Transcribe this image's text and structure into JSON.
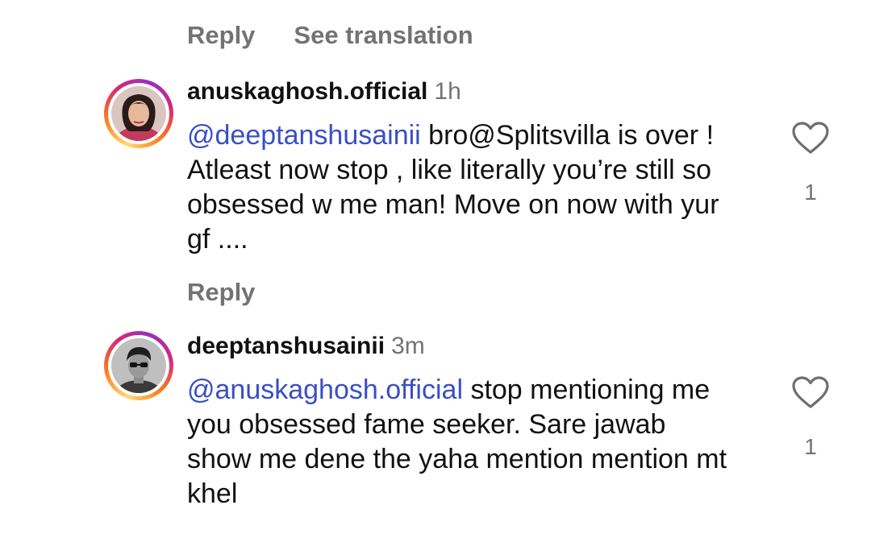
{
  "top": {
    "reply_label": "Reply",
    "see_translation_label": "See translation"
  },
  "comments": [
    {
      "username": "anuskaghosh.official",
      "time": "1h",
      "mention": "@deeptanshusainii",
      "text_rest": " bro@Splitsvilla is over ! Atleast now stop , like literally you’re still so obsessed w me man! Move on now with yur gf ....",
      "like_count": "1",
      "reply_label": "Reply",
      "avatar_icon": "profile-photo-woman"
    },
    {
      "username": "deeptanshusainii",
      "time": "3m",
      "mention": "@anuskaghosh.official",
      "text_rest": " stop mentioning me you obsessed fame seeker. Sare jawab show me dene the yaha mention mention mt khel",
      "like_count": "1",
      "avatar_icon": "profile-photo-man"
    }
  ],
  "colors": {
    "mention": "#3a4fc4",
    "secondary_text": "#737373",
    "primary_text": "#111111"
  }
}
